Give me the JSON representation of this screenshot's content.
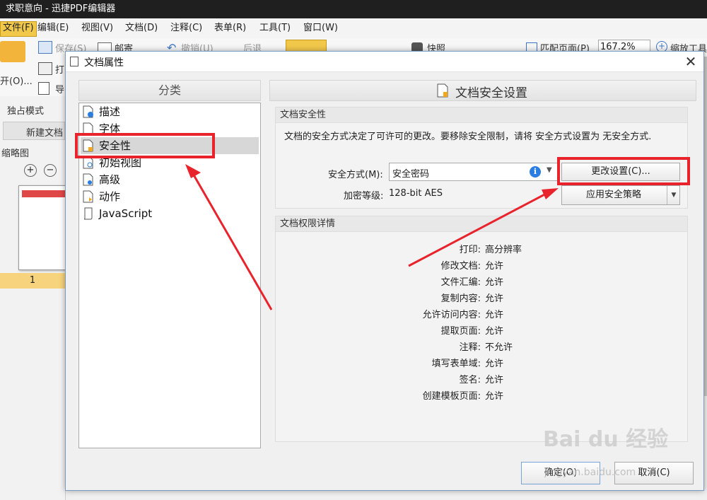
{
  "app": {
    "title": "求职意向 - 迅捷PDF编辑器",
    "menu": [
      "文件(F)",
      "编辑(E)",
      "视图(V)",
      "文档(D)",
      "注释(C)",
      "表单(R)",
      "工具(T)",
      "窗口(W)"
    ],
    "toolbar": {
      "open_label": "开(O)...",
      "save": "保存(S)",
      "mail": "邮寄",
      "undo": "撤销(U)",
      "back": "后退",
      "snapshot": "快照",
      "fit_page": "匹配页面(P)",
      "zoom": "167.2%",
      "zoom_tool": "缩放工具",
      "print": "打",
      "export": "导",
      "exclusive_mode": "独占模式",
      "new_doc_tab": "新建文档",
      "thumbnails": "缩略图",
      "page_number": "1"
    }
  },
  "dialog": {
    "title": "文档属性",
    "close_glyph": "✕",
    "category_header": "分类",
    "categories": [
      {
        "label": "描述",
        "icon": "doc-info-icon",
        "selected": false
      },
      {
        "label": "字体",
        "icon": "doc-font-icon",
        "selected": false
      },
      {
        "label": "安全性",
        "icon": "doc-lock-icon",
        "selected": true
      },
      {
        "label": "初始视图",
        "icon": "doc-view-icon",
        "selected": false
      },
      {
        "label": "高级",
        "icon": "doc-gear-icon",
        "selected": false
      },
      {
        "label": "动作",
        "icon": "doc-action-icon",
        "selected": false
      },
      {
        "label": "JavaScript",
        "icon": "script-icon",
        "selected": false
      }
    ],
    "section_header": "文档安全设置",
    "security": {
      "box_title": "文档安全性",
      "description": "文档的安全方式决定了可许可的更改。要移除安全限制，请将 安全方式设置为 无安全方式.",
      "method_label": "安全方式(M):",
      "method_value": "安全密码",
      "level_label": "加密等级:",
      "level_value": "128-bit AES",
      "change_button": "更改设置(C)...",
      "policy_button": "应用安全策略"
    },
    "permissions": {
      "box_title": "文档权限详情",
      "rows": [
        {
          "key": "打印:",
          "value": "高分辨率"
        },
        {
          "key": "修改文档:",
          "value": "允许"
        },
        {
          "key": "文件汇编:",
          "value": "允许"
        },
        {
          "key": "复制内容:",
          "value": "允许"
        },
        {
          "key": "允许访问内容:",
          "value": "允许"
        },
        {
          "key": "提取页面:",
          "value": "允许"
        },
        {
          "key": "注释:",
          "value": "不允许"
        },
        {
          "key": "填写表单域:",
          "value": "允许"
        },
        {
          "key": "签名:",
          "value": "允许"
        },
        {
          "key": "创建模板页面:",
          "value": "允许"
        }
      ]
    },
    "ok_button": "确定(O)",
    "cancel_button": "取消(C)"
  },
  "overlay": {
    "highlight_color": "#e8232c",
    "watermark": "Bai du 经验",
    "watermark_sub": "jingyan.baidu.com"
  }
}
